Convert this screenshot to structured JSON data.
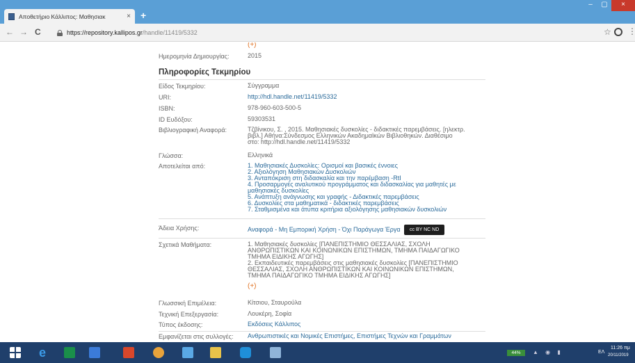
{
  "browser": {
    "tab_title": "Αποθετήριο Κάλλιπος: Μαθησιακ",
    "tab_close": "×",
    "newtab": "+",
    "url_host": "https://repository.kallipos.gr",
    "url_path": "/handle/11419/5332",
    "back": "←",
    "forward": "→",
    "reload": "C",
    "star": "☆",
    "menu": "⋮",
    "minimize": "–",
    "maximize": "▢",
    "close": "×"
  },
  "page": {
    "top_more": "(+)",
    "created_label": "Ημερομηνία Δημιουργίας:",
    "created_value": "2015",
    "section_title": "Πληροφορίες Τεκμηρίου",
    "fields": {
      "type_label": "Είδος Τεκμηρίου:",
      "type_value": "Σύγγραμμα",
      "uri_label": "URI:",
      "uri_value": "http://hdl.handle.net/11419/5332",
      "isbn_label": "ISBN:",
      "isbn_value": "978-960-603-500-5",
      "eudoxus_label": "ID Ευδόξου:",
      "eudoxus_value": "59303531",
      "citation_label": "Βιβλιογραφική Αναφορά:",
      "citation_lines": [
        "Τζβίνικου, Σ. , 2015. Μαθησιακές δυσκολίες - διδακτικές παρεμβάσεις. [ηλεκτρ.",
        "βιβλ.] Αθήνα:Σύνδεσμος Ελληνικών Ακαδημαϊκών Βιβλιοθηκών. Διαθέσιμο",
        "στο: http://hdl.handle.net/11419/5332"
      ],
      "language_label": "Γλώσσα:",
      "language_value": "Ελληνικά",
      "consists_label": "Αποτελείται από:",
      "chapters": [
        "1. Μαθησιακές Δυσκολίες: Ορισμοί και βασικές έννοιες",
        "2. Αξιολόγηση Μαθησιακών Δυσκολιών",
        "3. Ανταπόκριση στη διδασκαλία και την παρέμβαση -RtI",
        "4. Προσαρμογές αναλυτικού προγράμματος και διδασκαλίας για μαθητές με",
        "μαθησιακές δυσκολίες",
        "5. Ανάπτυξη ανάγνωσης και γραφής - Διδακτικές παρεμβάσεις",
        "6. Δυσκολίες στα μαθηματικά - διδακτικές παρεμβάσεις",
        "7. Σταθμισμένα και άτυπα κριτήρια αξιολόγησης μαθησιακών δυσκολιών"
      ],
      "license_label": "Άδεια Χρήσης:",
      "license_value": "Αναφορά - Μη Εμπορική Χρήση - Όχι Παράγωγα Έργα",
      "license_badge": "cc BY NC ND",
      "courses_label": "Σχετικά Μαθήματα:",
      "courses": [
        "1. Μαθησιακές δυσκολίες [ΠΑΝΕΠΙΣΤΗΜΙΟ ΘΕΣΣΑΛΙΑΣ, ΣΧΟΛΗ",
        "ΑΝΘΡΩΠΙΣΤΙΚΩΝ ΚΑΙ ΚΟΙΝΩΝΙΚΩΝ ΕΠΙΣΤΗΜΩΝ, ΤΜΗΜΑ ΠΑΙΔΑΓΩΓΙΚΟ",
        "ΤΜΗΜΑ ΕΙΔΙΚΗΣ ΑΓΩΓΗΣ]",
        "2. Εκπαιδευτικές παρεμβάσεις στις μαθησιακές δυσκολίες [ΠΑΝΕΠΙΣΤΗΜΙΟ",
        "ΘΕΣΣΑΛΙΑΣ, ΣΧΟΛΗ ΑΝΘΡΩΠΙΣΤΙΚΩΝ ΚΑΙ ΚΟΙΝΩΝΙΚΩΝ ΕΠΙΣΤΗΜΩΝ,",
        "ΤΜΗΜΑ ΠΑΙΔΑΓΩΓΙΚΟ ΤΜΗΜΑ ΕΙΔΙΚΗΣ ΑΓΩΓΗΣ]"
      ],
      "courses_more": "(+)",
      "editor_label": "Γλωσσική Επιμέλεια:",
      "editor_value": "Κίτσιου, Σταυρούλα",
      "tech_label": "Τεχνική Επεξεργασία:",
      "tech_value": "Λουκέρη, Σοφία",
      "publisher_label": "Τύπος έκδοσης:",
      "publisher_value": "Εκδόσεις Κάλλιπος",
      "collections_label": "Εμφανίζεται στις συλλογές:",
      "collections_value": "Ανθρωπιστικές και Νομικές Επιστήμες, Επιστήμες Τεχνών και Γραμμάτων"
    }
  },
  "taskbar": {
    "battery": "44%",
    "lang": "ΕΛ",
    "time": "11:26 πμ",
    "date": "20/11/2019",
    "icons": [
      "windows-start",
      "internet-explorer",
      "store",
      "file-explorer-window",
      "pdf-reader",
      "chrome",
      "photos",
      "folder",
      "skype",
      "notepad"
    ]
  },
  "colors": {
    "titlebar": "#5a9fd6",
    "link": "#2a6a9a",
    "accent": "#e07020",
    "taskbar": "#1f3f6b"
  }
}
